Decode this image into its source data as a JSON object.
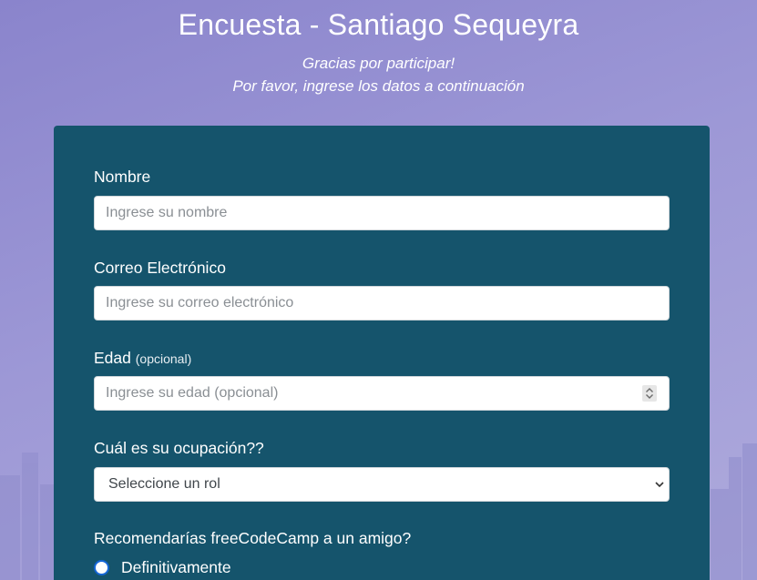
{
  "header": {
    "title": "Encuesta - Santiago Sequeyra",
    "description_line1": "Gracias por participar!",
    "description_line2": "Por favor, ingrese los datos a continuación"
  },
  "form": {
    "name": {
      "label": "Nombre",
      "placeholder": "Ingrese su nombre",
      "value": ""
    },
    "email": {
      "label": "Correo Electrónico",
      "placeholder": "Ingrese su correo electrónico",
      "value": ""
    },
    "age": {
      "label": "Edad",
      "label_note": "(opcional)",
      "placeholder": "Ingrese su edad (opcional)",
      "value": "",
      "spinner_icon": "number-spinner-icon"
    },
    "role": {
      "label": "Cuál es su ocupación??",
      "selected": "Seleccione un rol",
      "arrow_icon": "chevron-down-icon"
    },
    "recommend": {
      "question": "Recomendarías freeCodeCamp a un amigo?",
      "options": [
        "Definitivamente"
      ]
    }
  },
  "colors": {
    "background": "#9d98d6",
    "card": "#15546c",
    "radio_accent": "#1566d6"
  }
}
